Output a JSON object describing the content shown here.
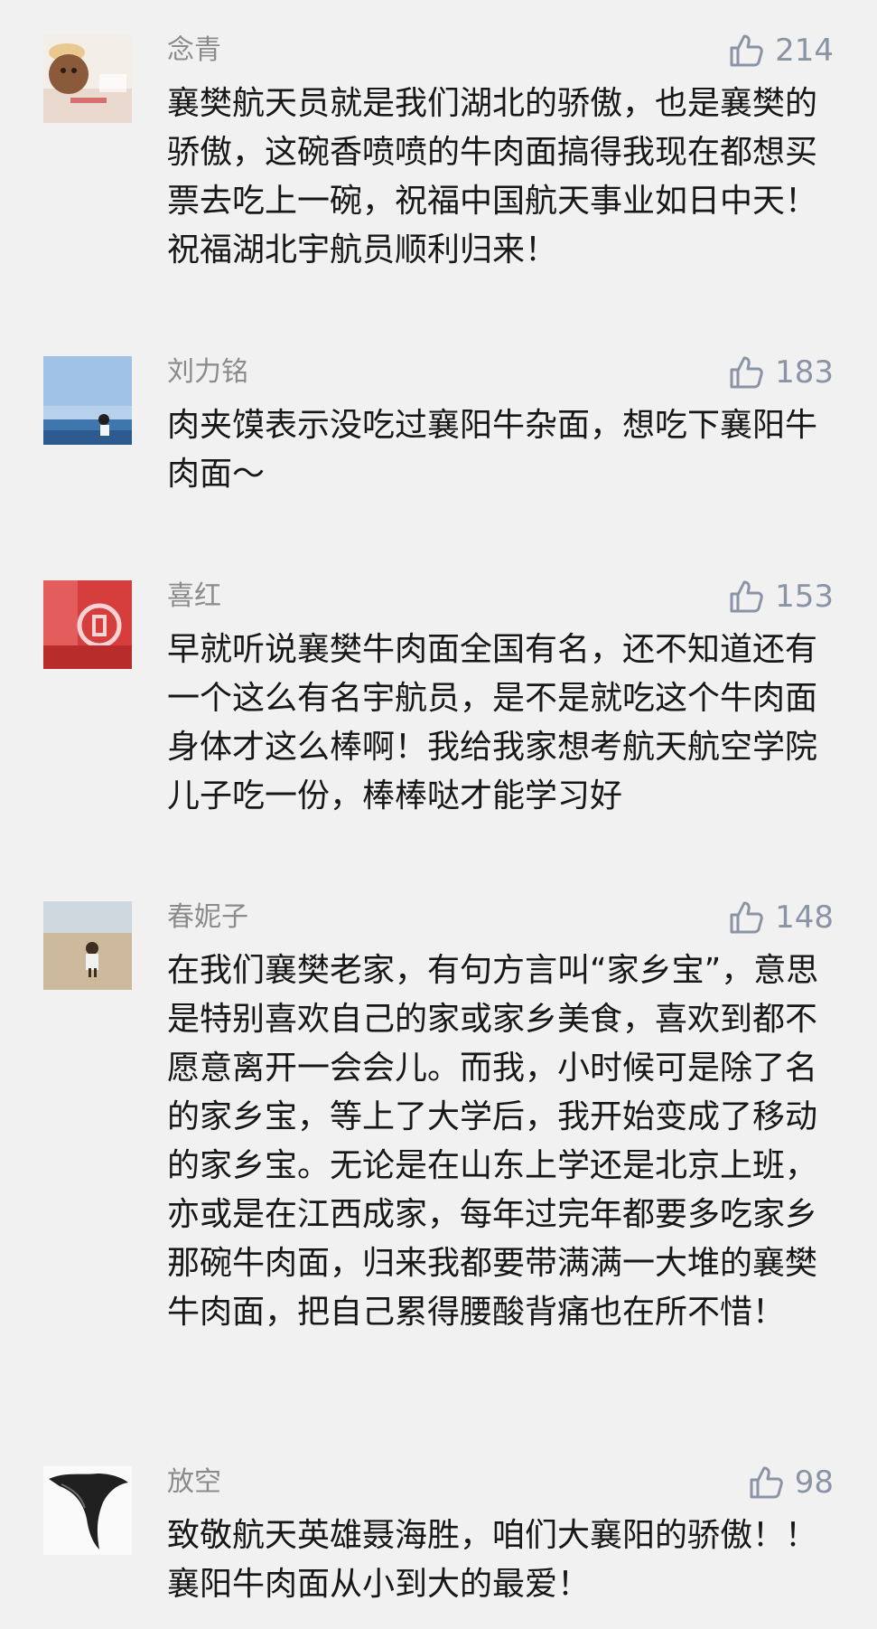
{
  "comments": [
    {
      "username": "念青",
      "likes": "214",
      "text": "襄樊航天员就是我们湖北的骄傲，也是襄樊的骄傲，这碗香喷喷的牛肉面搞得我现在都想买票去吃上一碗，祝福中国航天事业如日中天！祝福湖北宇航员顺利归来！"
    },
    {
      "username": "刘力铭",
      "likes": "183",
      "text": "肉夹馍表示没吃过襄阳牛杂面，想吃下襄阳牛肉面～"
    },
    {
      "username": "喜红",
      "likes": "153",
      "text": "早就听说襄樊牛肉面全国有名，还不知道还有一个这么有名宇航员，是不是就吃这个牛肉面身体才这么棒啊！我给我家想考航天航空学院儿子吃一份，棒棒哒才能学习好"
    },
    {
      "username": "春妮子",
      "likes": "148",
      "text": "在我们襄樊老家，有句方言叫“家乡宝”，意思是特别喜欢自己的家或家乡美食，喜欢到都不愿意离开一会会儿。而我，小时候可是除了名的家乡宝，等上了大学后，我开始变成了移动的家乡宝。无论是在山东上学还是北京上班，亦或是在江西成家，每年过完年都要多吃家乡那碗牛肉面，归来我都要带满满一大堆的襄樊牛肉面，把自己累得腰酸背痛也在所不惜！"
    },
    {
      "username": "放空",
      "likes": "98",
      "text": "致敬航天英雄聂海胜，咱们大襄阳的骄傲！！襄阳牛肉面从小到大的最爱！"
    }
  ],
  "icons": {
    "like": "thumbs-up-icon"
  },
  "colors": {
    "background": "#f1f1f1",
    "username": "#8b8b8b",
    "likes": "#8a94a6",
    "text": "#171717"
  }
}
